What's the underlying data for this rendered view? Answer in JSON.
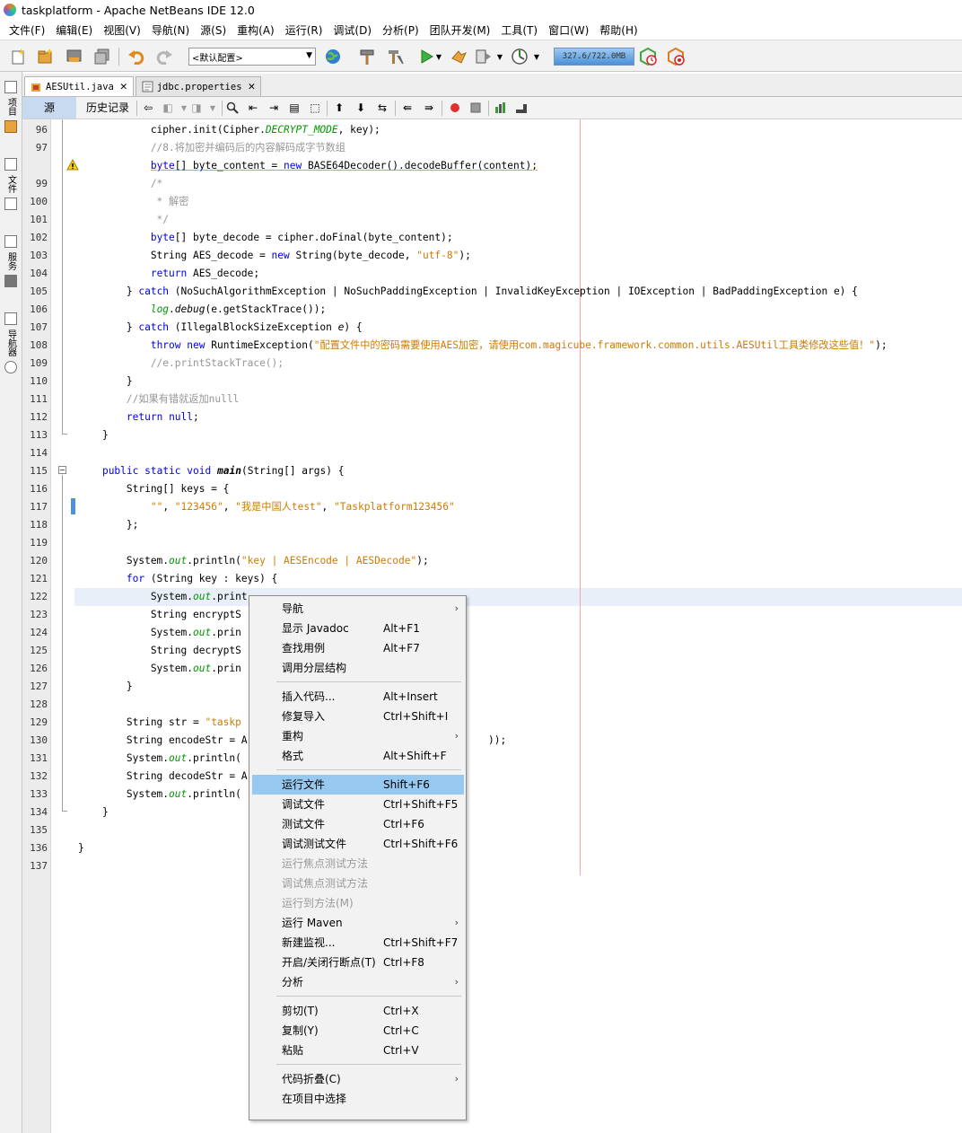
{
  "window": {
    "title": "taskplatform - Apache NetBeans IDE 12.0"
  },
  "menubar": [
    "文件(F)",
    "编辑(E)",
    "视图(V)",
    "导航(N)",
    "源(S)",
    "重构(A)",
    "运行(R)",
    "调试(D)",
    "分析(P)",
    "团队开发(M)",
    "工具(T)",
    "窗口(W)",
    "帮助(H)"
  ],
  "toolbar": {
    "config_value": "<默认配置>",
    "memory": "327.6/722.0MB"
  },
  "sidebar": {
    "labels": [
      "项目",
      "文件",
      "服务",
      "导航器"
    ]
  },
  "tabs": [
    {
      "label": "AESUtil.java",
      "active": true
    },
    {
      "label": "jdbc.properties",
      "active": false
    }
  ],
  "editor_toolbar": {
    "source_tab": "源",
    "history_tab": "历史记录"
  },
  "editor": {
    "lines": [
      {
        "num": "96",
        "code": [
          [
            "t",
            "            cipher.init(Cipher."
          ],
          [
            "fld",
            "DECRYPT_MODE"
          ],
          [
            "t",
            ", key);"
          ]
        ]
      },
      {
        "num": "97",
        "code": [
          [
            "cm",
            "            //8.将加密并编码后的内容解码成字节数组"
          ]
        ]
      },
      {
        "num": "",
        "warn": true,
        "code": [
          [
            "t",
            "            "
          ],
          [
            "kw",
            "byte"
          ],
          [
            "t",
            "[] byte_content = "
          ],
          [
            "kw",
            "new"
          ],
          [
            "t",
            " BASE64Decoder().decodeBuffer(content);"
          ]
        ]
      },
      {
        "num": "99",
        "code": [
          [
            "cm",
            "            /*"
          ]
        ]
      },
      {
        "num": "100",
        "code": [
          [
            "cm",
            "             * 解密"
          ]
        ]
      },
      {
        "num": "101",
        "code": [
          [
            "cm",
            "             */"
          ]
        ]
      },
      {
        "num": "102",
        "code": [
          [
            "t",
            "            "
          ],
          [
            "kw",
            "byte"
          ],
          [
            "t",
            "[] byte_decode = cipher.doFinal(byte_content);"
          ]
        ]
      },
      {
        "num": "103",
        "code": [
          [
            "t",
            "            String AES_decode = "
          ],
          [
            "kw",
            "new"
          ],
          [
            "t",
            " String(byte_decode, "
          ],
          [
            "str",
            "\"utf-8\""
          ],
          [
            "t",
            ");"
          ]
        ]
      },
      {
        "num": "104",
        "code": [
          [
            "t",
            "            "
          ],
          [
            "kw",
            "return"
          ],
          [
            "t",
            " AES_decode;"
          ]
        ]
      },
      {
        "num": "105",
        "code": [
          [
            "t",
            "        } "
          ],
          [
            "kw",
            "catch"
          ],
          [
            "t",
            " (NoSuchAlgorithmException | NoSuchPaddingException | InvalidKeyException | IOException | BadPaddingException e) {"
          ]
        ]
      },
      {
        "num": "106",
        "code": [
          [
            "t",
            "            "
          ],
          [
            "fld",
            "log"
          ],
          [
            "t",
            "."
          ],
          [
            "ital",
            "debug"
          ],
          [
            "t",
            "(e.getStackTrace());"
          ]
        ]
      },
      {
        "num": "107",
        "code": [
          [
            "t",
            "        } "
          ],
          [
            "kw",
            "catch"
          ],
          [
            "t",
            " (IllegalBlockSizeException "
          ],
          [
            "ital",
            "e"
          ],
          [
            "t",
            ") {"
          ]
        ]
      },
      {
        "num": "108",
        "code": [
          [
            "t",
            "            "
          ],
          [
            "kw",
            "throw"
          ],
          [
            "t",
            " "
          ],
          [
            "kw",
            "new"
          ],
          [
            "t",
            " RuntimeException("
          ],
          [
            "str",
            "\"配置文件中的密码需要使用AES加密，请使用com.magicube.framework.common.utils.AESUtil工具类修改这些值！\""
          ],
          [
            "t",
            ");"
          ]
        ]
      },
      {
        "num": "109",
        "code": [
          [
            "cm",
            "            //e.printStackTrace();"
          ]
        ]
      },
      {
        "num": "110",
        "code": [
          [
            "t",
            "        }"
          ]
        ]
      },
      {
        "num": "111",
        "code": [
          [
            "cm",
            "        //如果有错就返加nulll"
          ]
        ]
      },
      {
        "num": "112",
        "code": [
          [
            "t",
            "        "
          ],
          [
            "kw",
            "return"
          ],
          [
            "t",
            " "
          ],
          [
            "kw",
            "null"
          ],
          [
            "t",
            ";"
          ]
        ]
      },
      {
        "num": "113",
        "code": [
          [
            "t",
            "    }"
          ]
        ]
      },
      {
        "num": "114",
        "code": []
      },
      {
        "num": "115",
        "code": [
          [
            "t",
            "    "
          ],
          [
            "kw",
            "public"
          ],
          [
            "t",
            " "
          ],
          [
            "kw",
            "static"
          ],
          [
            "t",
            " "
          ],
          [
            "kw",
            "void"
          ],
          [
            "t",
            " "
          ],
          [
            "bi",
            "main"
          ],
          [
            "t",
            "(String[] args) {"
          ]
        ]
      },
      {
        "num": "116",
        "code": [
          [
            "t",
            "        String[] keys = {"
          ]
        ]
      },
      {
        "num": "117",
        "code": [
          [
            "t",
            "            "
          ],
          [
            "str",
            "\"\""
          ],
          [
            "t",
            ", "
          ],
          [
            "str",
            "\"123456\""
          ],
          [
            "t",
            ", "
          ],
          [
            "str",
            "\"我是中国人test\""
          ],
          [
            "t",
            ", "
          ],
          [
            "str",
            "\"Taskplatform123456\""
          ]
        ]
      },
      {
        "num": "118",
        "code": [
          [
            "t",
            "        };"
          ]
        ]
      },
      {
        "num": "119",
        "code": []
      },
      {
        "num": "120",
        "code": [
          [
            "t",
            "        System."
          ],
          [
            "fld",
            "out"
          ],
          [
            "t",
            ".println("
          ],
          [
            "str",
            "\"key | AESEncode | AESDecode\""
          ],
          [
            "t",
            ");"
          ]
        ]
      },
      {
        "num": "121",
        "code": [
          [
            "t",
            "        "
          ],
          [
            "kw",
            "for"
          ],
          [
            "t",
            " (String key : keys) {"
          ]
        ]
      },
      {
        "num": "122",
        "code": [
          [
            "t",
            "            System."
          ],
          [
            "fld",
            "out"
          ],
          [
            "t",
            ".print"
          ]
        ]
      },
      {
        "num": "123",
        "code": [
          [
            "t",
            "            String encryptS"
          ]
        ]
      },
      {
        "num": "124",
        "code": [
          [
            "t",
            "            System."
          ],
          [
            "fld",
            "out"
          ],
          [
            "t",
            ".prin"
          ]
        ]
      },
      {
        "num": "125",
        "code": [
          [
            "t",
            "            String decryptS"
          ]
        ]
      },
      {
        "num": "126",
        "code": [
          [
            "t",
            "            System."
          ],
          [
            "fld",
            "out"
          ],
          [
            "t",
            ".prin"
          ]
        ]
      },
      {
        "num": "127",
        "code": [
          [
            "t",
            "        }"
          ]
        ]
      },
      {
        "num": "128",
        "code": []
      },
      {
        "num": "129",
        "code": [
          [
            "t",
            "        String str = "
          ],
          [
            "str",
            "\"taskp"
          ]
        ]
      },
      {
        "num": "130",
        "code": [
          [
            "t",
            "        String encodeStr = A"
          ]
        ]
      },
      {
        "num": "131",
        "code": [
          [
            "t",
            "        System."
          ],
          [
            "fld",
            "out"
          ],
          [
            "t",
            ".println("
          ]
        ]
      },
      {
        "num": "132",
        "code": [
          [
            "t",
            "        String decodeStr = A"
          ]
        ]
      },
      {
        "num": "133",
        "code": [
          [
            "t",
            "        System."
          ],
          [
            "fld",
            "out"
          ],
          [
            "t",
            ".println("
          ]
        ]
      },
      {
        "num": "134",
        "code": [
          [
            "t",
            "    }"
          ]
        ]
      },
      {
        "num": "135",
        "code": []
      },
      {
        "num": "136",
        "code": [
          [
            "t",
            "}"
          ]
        ]
      },
      {
        "num": "137",
        "code": []
      }
    ],
    "line130_tail": "));"
  },
  "context_menu": {
    "items": [
      {
        "label": "导航",
        "accel": "",
        "submenu": true
      },
      {
        "label": "显示 Javadoc",
        "accel": "Alt+F1"
      },
      {
        "label": "查找用例",
        "accel": "Alt+F7"
      },
      {
        "label": "调用分层结构",
        "accel": ""
      },
      {
        "sep": true
      },
      {
        "label": "插入代码...",
        "accel": "Alt+Insert"
      },
      {
        "label": "修复导入",
        "accel": "Ctrl+Shift+I"
      },
      {
        "label": "重构",
        "accel": "",
        "submenu": true
      },
      {
        "label": "格式",
        "accel": "Alt+Shift+F"
      },
      {
        "sep": true
      },
      {
        "label": "运行文件",
        "accel": "Shift+F6",
        "hover": true
      },
      {
        "label": "调试文件",
        "accel": "Ctrl+Shift+F5"
      },
      {
        "label": "测试文件",
        "accel": "Ctrl+F6"
      },
      {
        "label": "调试测试文件",
        "accel": "Ctrl+Shift+F6"
      },
      {
        "label": "运行焦点测试方法",
        "accel": "",
        "disabled": true
      },
      {
        "label": "调试焦点测试方法",
        "accel": "",
        "disabled": true
      },
      {
        "label": "运行到方法(M)",
        "accel": "",
        "disabled": true
      },
      {
        "label": "运行 Maven",
        "accel": "",
        "submenu": true
      },
      {
        "label": "新建监视...",
        "accel": "Ctrl+Shift+F7"
      },
      {
        "label": "开启/关闭行断点(T)",
        "accel": "Ctrl+F8"
      },
      {
        "label": "分析",
        "accel": "",
        "submenu": true
      },
      {
        "sep": true
      },
      {
        "label": "剪切(T)",
        "accel": "Ctrl+X"
      },
      {
        "label": "复制(Y)",
        "accel": "Ctrl+C"
      },
      {
        "label": "粘贴",
        "accel": "Ctrl+V"
      },
      {
        "sep": true
      },
      {
        "label": "代码折叠(C)",
        "accel": "",
        "submenu": true
      },
      {
        "label": "在项目中选择",
        "accel": ""
      }
    ]
  },
  "colors": {
    "keyword": "#0000e6",
    "string": "#ce7b00",
    "comment": "#969696",
    "field": "#009900",
    "menu_hover": "#96c8f0",
    "tab_source": "#c8daf0"
  }
}
